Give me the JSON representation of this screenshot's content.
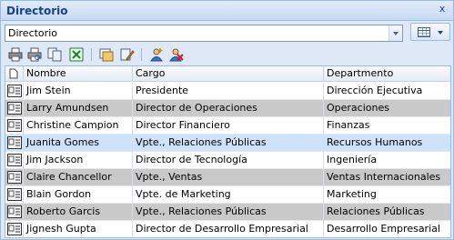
{
  "window": {
    "title": "Directorio",
    "close_label": "x"
  },
  "combo": {
    "value": "Directorio"
  },
  "toolbar": {
    "icons": [
      "print-icon",
      "print-preview-icon",
      "copy-icon",
      "excel-export-icon",
      "group-icon",
      "edit-icon",
      "add-user-icon",
      "remove-user-icon"
    ]
  },
  "grid": {
    "columns": [
      "Nombre",
      "Cargo",
      "Departmento"
    ],
    "rows": [
      {
        "nombre": "Jim Stein",
        "cargo": "Presidente",
        "departamento": "Dirección Ejecutiva"
      },
      {
        "nombre": "Larry  Amundsen",
        "cargo": "Director de Operaciones",
        "departamento": "Operaciones"
      },
      {
        "nombre": "Christine  Campion",
        "cargo": "Director Financiero",
        "departamento": "Finanzas"
      },
      {
        "nombre": "Juanita  Gomes",
        "cargo": "Vpte., Relaciones Públicas",
        "departamento": "Recursos Humanos"
      },
      {
        "nombre": "Jim  Jackson",
        "cargo": "Director de Tecnología",
        "departamento": "Ingeniería"
      },
      {
        "nombre": "Claire  Chancellor",
        "cargo": "Vpte., Ventas",
        "departamento": "Ventas Internacionales"
      },
      {
        "nombre": "Blain Gordon",
        "cargo": "Vpte. de Marketing",
        "departamento": "Marketing"
      },
      {
        "nombre": "Roberto  Garcis",
        "cargo": "Vpte., Relaciones Públicas",
        "departamento": "Relaciones Públicas"
      },
      {
        "nombre": "Jignesh  Gupta",
        "cargo": "Director de Desarrollo Empresarial",
        "departamento": "Desarrollo Empresarial"
      }
    ]
  }
}
